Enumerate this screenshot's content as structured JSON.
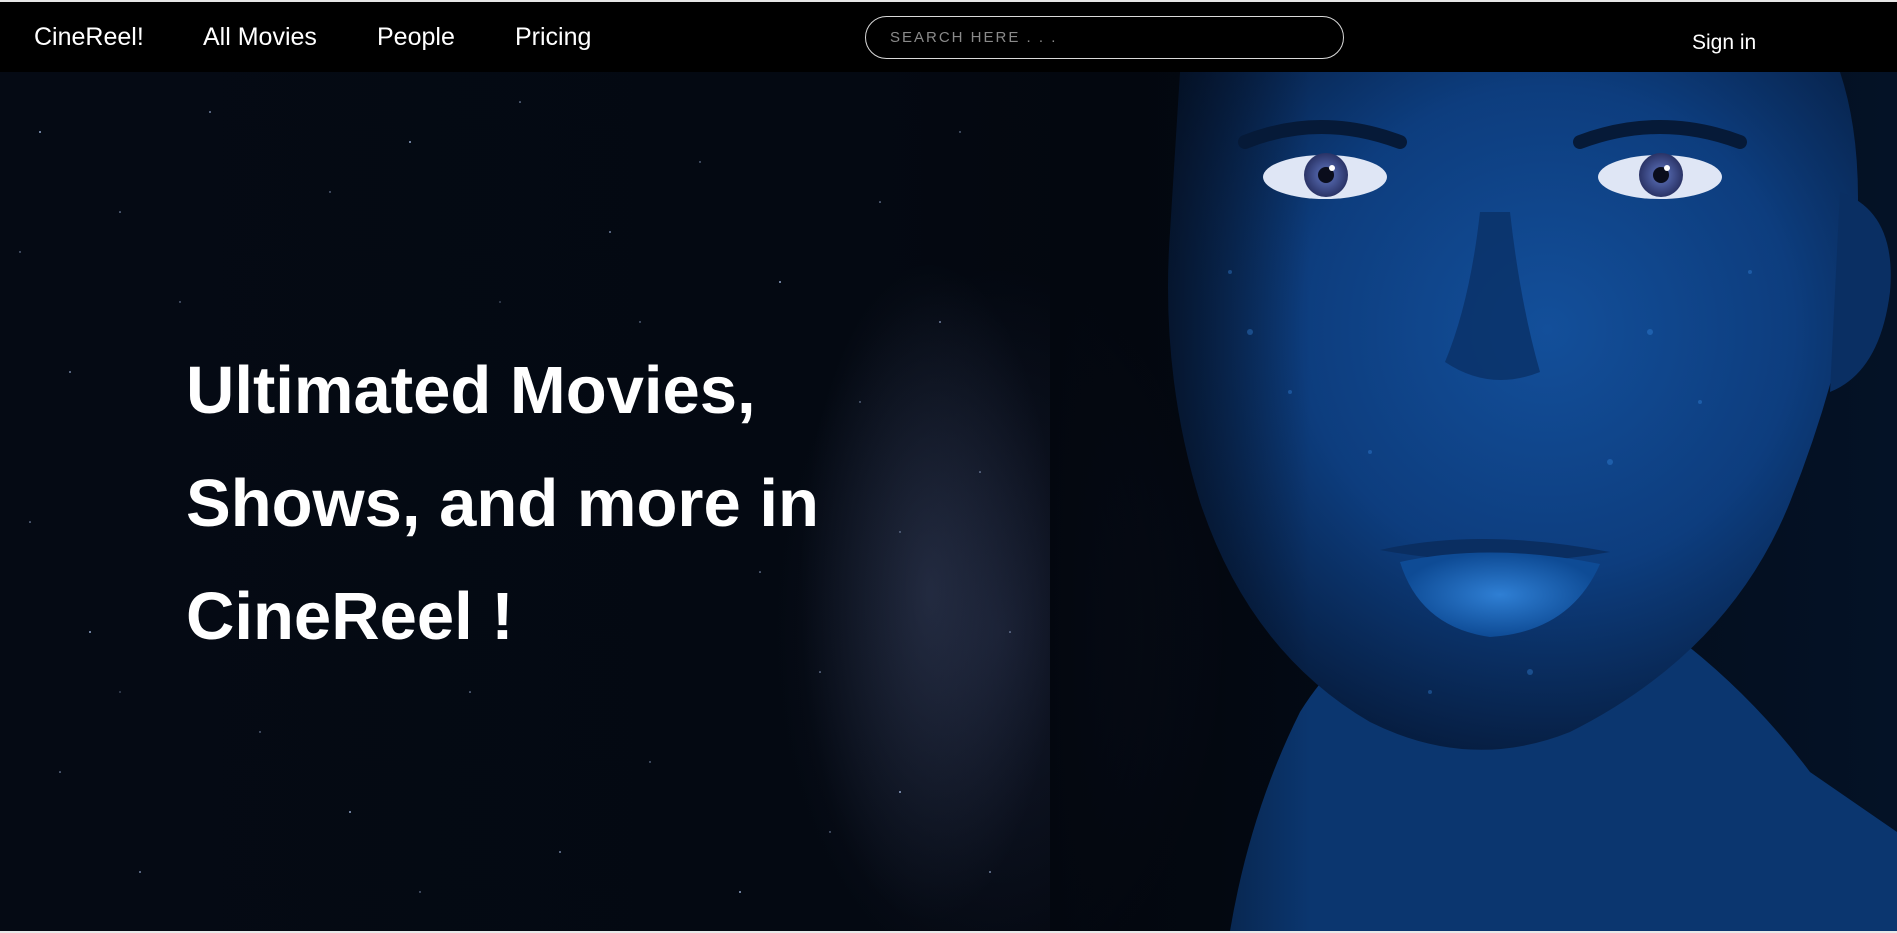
{
  "nav": {
    "brand": "CineReel!",
    "links": [
      {
        "label": "All Movies"
      },
      {
        "label": "People"
      },
      {
        "label": "Pricing"
      }
    ],
    "search": {
      "placeholder": "SEARCH HERE . . .",
      "value": ""
    },
    "sign_in": "Sign in"
  },
  "hero": {
    "headline": "Ultimated Movies, Shows, and more in CineReel !",
    "image_subject": "blue-painted-face-portrait"
  },
  "colors": {
    "navbar_bg": "#000000",
    "text": "#ffffff",
    "hero_bg": "#040912",
    "face_blue": "#0f4fa0"
  }
}
